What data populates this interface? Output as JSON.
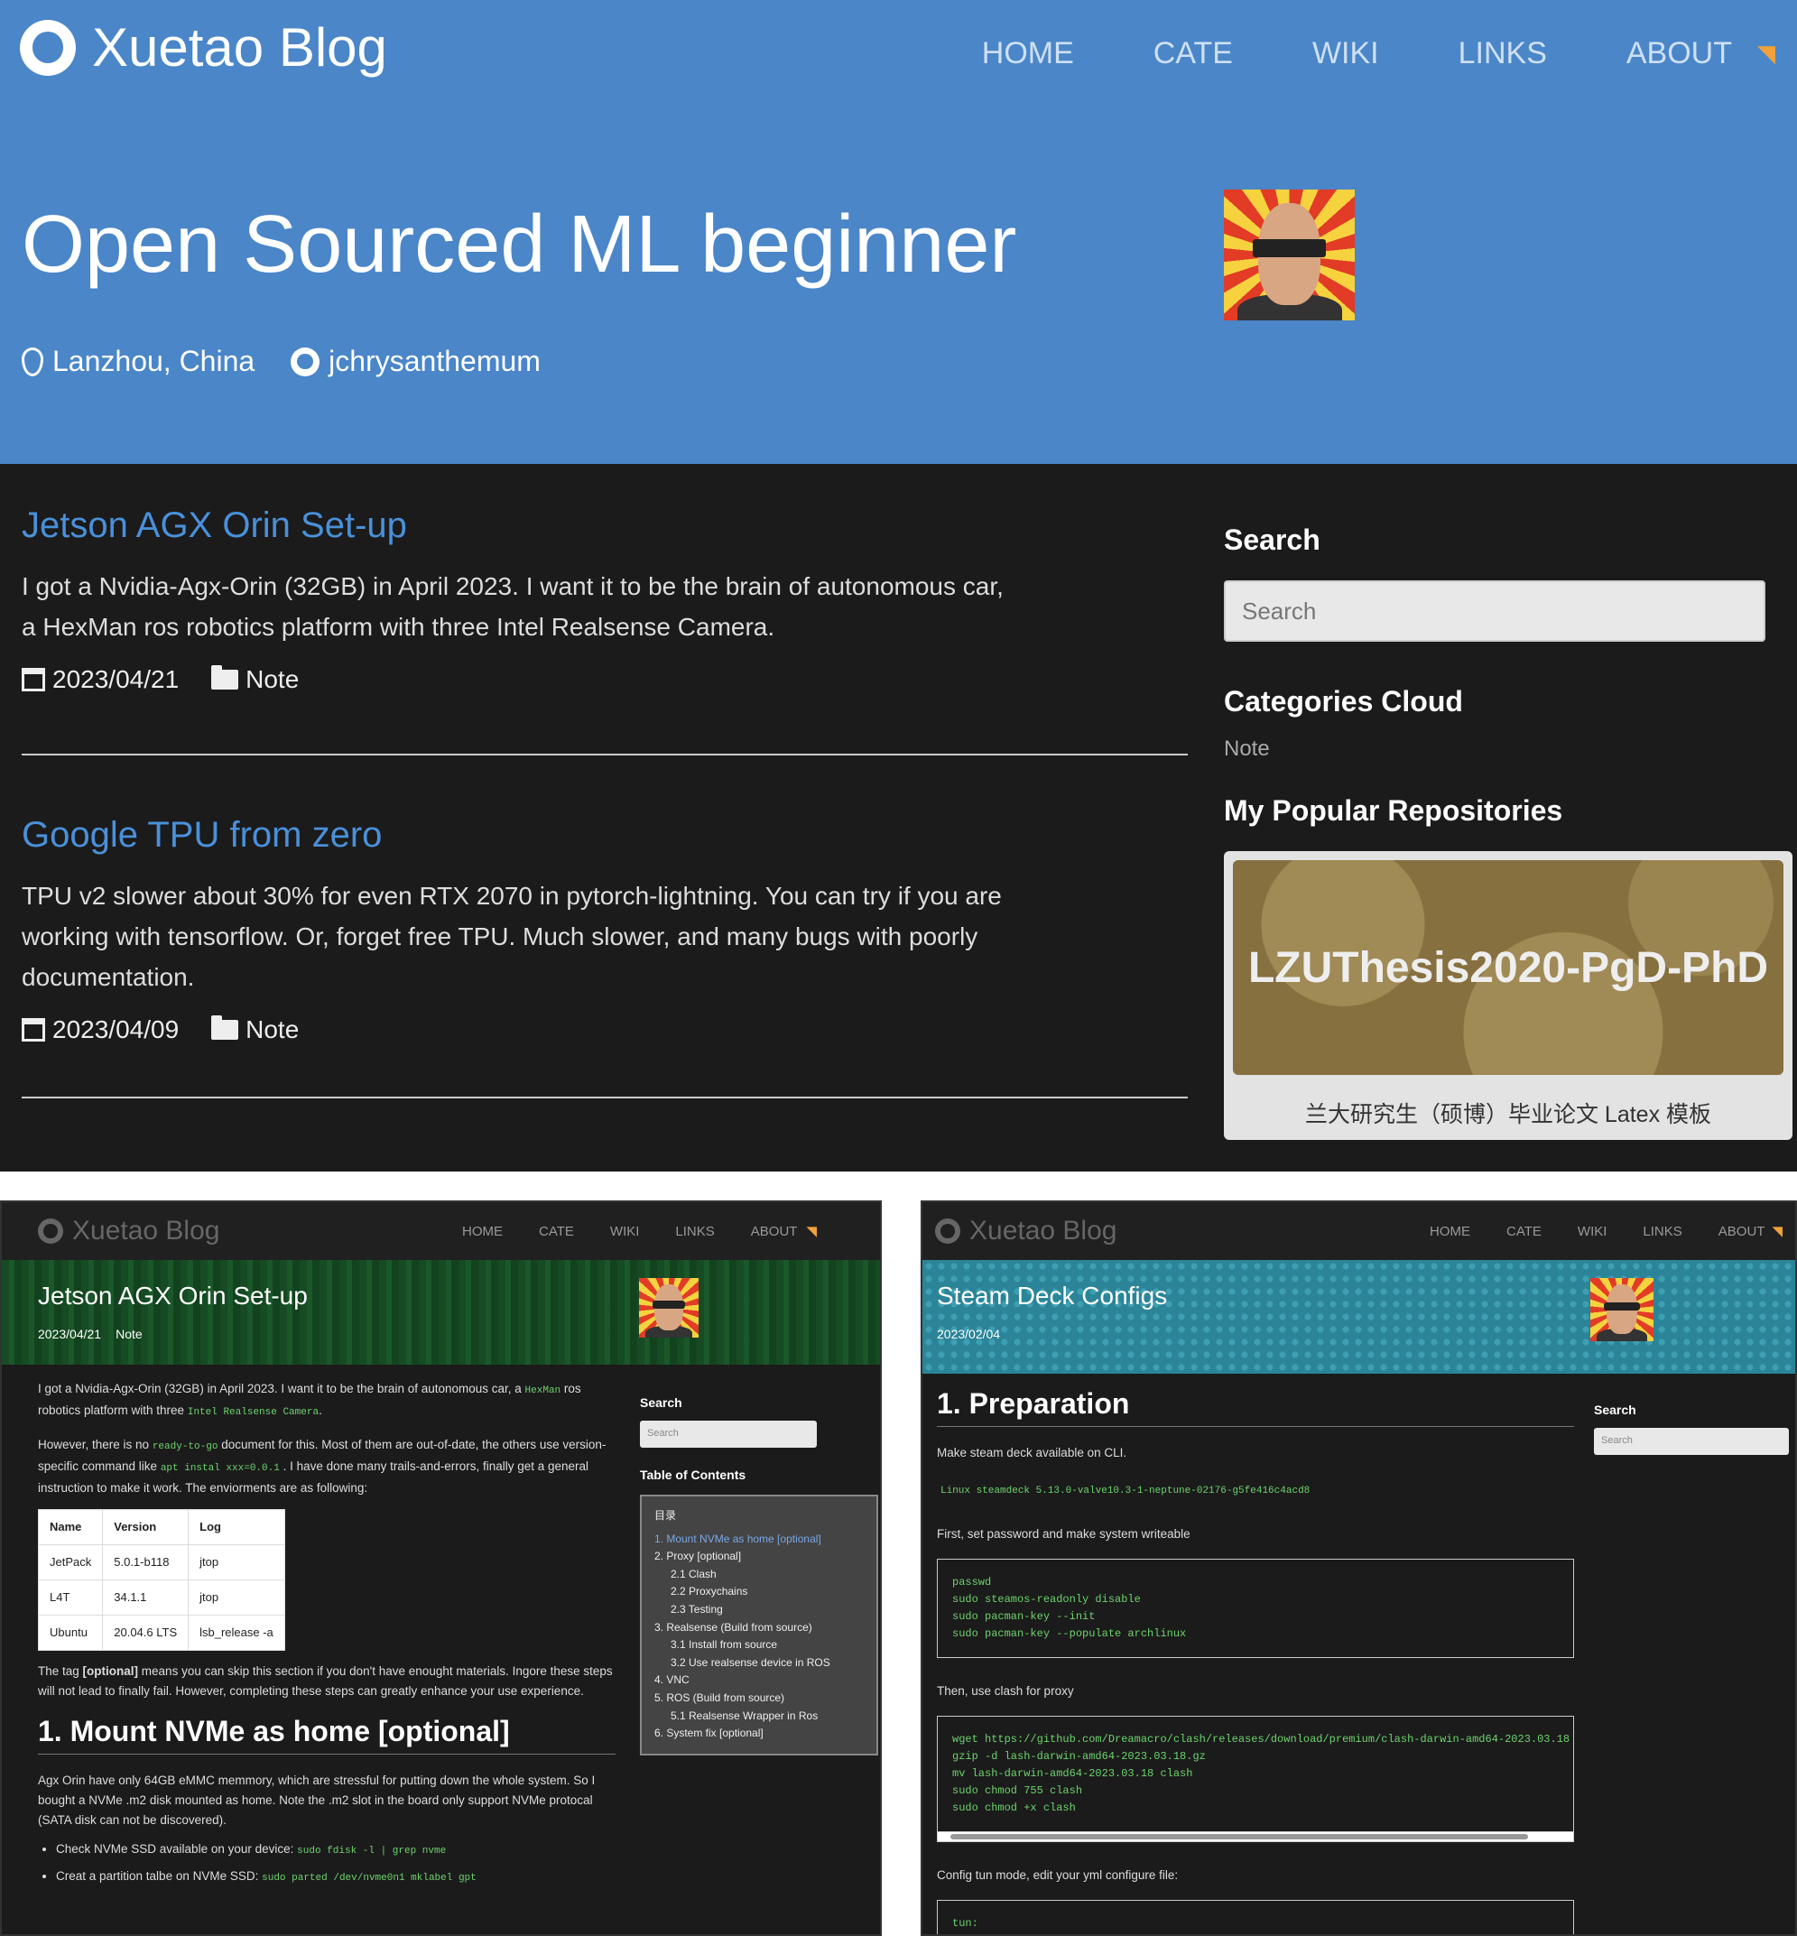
{
  "site": {
    "brand": "Xuetao Blog",
    "nav": [
      "HOME",
      "CATE",
      "WIKI",
      "LINKS",
      "ABOUT"
    ]
  },
  "hero": {
    "title": "Open Sourced ML beginner",
    "location": "Lanzhou, China",
    "github": "jchrysanthemum"
  },
  "posts": [
    {
      "title": "Jetson AGX Orin Set-up",
      "excerpt": "I got a Nvidia-Agx-Orin (32GB) in April 2023. I want it to be the brain of autonomous car, a HexMan ros robotics platform with three Intel Realsense Camera.",
      "date": "2023/04/21",
      "category": "Note"
    },
    {
      "title": "Google TPU from zero",
      "excerpt": "TPU v2 slower about 30% for even RTX 2070 in pytorch-lightning. You can try if you are working with tensorflow. Or, forget free TPU. Much slower, and many bugs with poorly documentation.",
      "date": "2023/04/09",
      "category": "Note"
    }
  ],
  "sidebar": {
    "search_title": "Search",
    "search_placeholder": "Search",
    "categories_title": "Categories Cloud",
    "category": "Note",
    "repos_title": "My Popular Repositories",
    "repo_name": "LZUThesis2020-PgD-PhD",
    "repo_desc": "兰大研究生（硕博）毕业论文 Latex 模板"
  },
  "shot1": {
    "title": "Jetson AGX Orin Set-up",
    "date": "2023/04/21",
    "category": "Note",
    "p1a": "I got a Nvidia-Agx-Orin (32GB) in April 2023. I want it to be the brain of autonomous car, a",
    "p1code1": "HexMan",
    "p1b": "ros robotics platform with three",
    "p1code2": "Intel Realsense Camera",
    "p1c": ".",
    "p2a": "However, there is no",
    "p2code1": "ready-to-go",
    "p2b": "document for this. Most of them are out-of-date, the others use version-specific command like",
    "p2code2": "apt instal xxx=0.0.1",
    "p2c": ". I have done many trails-and-errors, finally get a general instruction to make it work. The enviorments are as following:",
    "table_headers": [
      "Name",
      "Version",
      "Log"
    ],
    "table_rows": [
      [
        "JetPack",
        "5.0.1-b118",
        "jtop"
      ],
      [
        "L4T",
        "34.1.1",
        "jtop"
      ],
      [
        "Ubuntu",
        "20.04.6 LTS",
        "lsb_release -a"
      ]
    ],
    "p3a": "The tag",
    "p3bold": "[optional]",
    "p3b": "means you can skip this section if you don't have enought materials. Ingore these steps will not lead to finally fail. However, completing these steps can greatly enhance your use experience.",
    "h1": "1. Mount NVMe as home [optional]",
    "p4": "Agx Orin have only 64GB eMMC memmory, which are stressful for putting down the whole system. So I bought a NVMe .m2 disk mounted as home. Note the .m2 slot in the board only support NVMe protocal (SATA disk can not be discovered).",
    "li1": "Check NVMe SSD available on your device:",
    "li1code": "sudo fdisk -l | grep nvme",
    "li2": "Creat a partition talbe on NVMe SSD:",
    "li2code": "sudo parted /dev/nvme0n1 mklabel gpt",
    "search": "Search",
    "search_placeholder": "Search",
    "toc_title": "Table of Contents",
    "toc_head": "目录",
    "toc": [
      "1. Mount NVMe as home [optional]",
      "2. Proxy [optional]",
      "2.1 Clash",
      "2.2 Proxychains",
      "2.3 Testing",
      "3. Realsense (Build from source)",
      "3.1 Install from source",
      "3.2 Use realsense device in ROS",
      "4. VNC",
      "5. ROS (Build from source)",
      "5.1 Realsense Wrapper in Ros",
      "6. System fix [optional]"
    ]
  },
  "shot2": {
    "title": "Steam Deck Configs",
    "date": "2023/02/04",
    "h1": "1. Preparation",
    "p1": "Make steam deck available on CLI.",
    "code1": "Linux steamdeck 5.13.0-valve10.3-1-neptune-02176-g5fe416c4acd8",
    "p2": "First, set password and make system writeable",
    "code2": "passwd\nsudo steamos-readonly disable\nsudo pacman-key --init\nsudo pacman-key --populate archlinux",
    "p3": "Then, use clash for proxy",
    "code3": "wget https://github.com/Dreamacro/clash/releases/download/premium/clash-darwin-amd64-2023.03.18\ngzip -d lash-darwin-amd64-2023.03.18.gz\nmv lash-darwin-amd64-2023.03.18 clash\nsudo chmod 755 clash\nsudo chmod +x clash",
    "p4": "Config tun mode, edit your yml configure file:",
    "code4": "tun:\n  enable: true",
    "search": "Search",
    "search_placeholder": "Search"
  }
}
